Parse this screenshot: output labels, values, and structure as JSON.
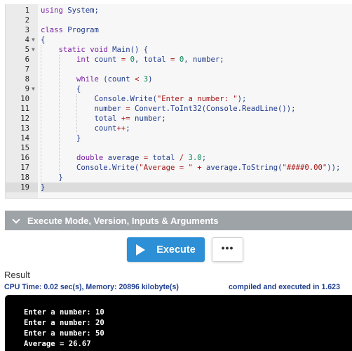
{
  "editor": {
    "lines": [
      {
        "n": "1",
        "tokens": [
          [
            "kw",
            "using"
          ],
          [
            "p",
            " System;"
          ]
        ]
      },
      {
        "n": "2",
        "tokens": []
      },
      {
        "n": "3",
        "tokens": [
          [
            "kw",
            "class"
          ],
          [
            "p",
            " Program"
          ]
        ]
      },
      {
        "n": "4",
        "fold": true,
        "tokens": [
          [
            "p",
            "{"
          ]
        ]
      },
      {
        "n": "5",
        "fold": true,
        "tokens": [
          [
            "p",
            "    "
          ],
          [
            "kw",
            "static"
          ],
          [
            "p",
            " "
          ],
          [
            "kw",
            "void"
          ],
          [
            "p",
            " Main() {"
          ]
        ]
      },
      {
        "n": "6",
        "tokens": [
          [
            "p",
            "        "
          ],
          [
            "ty",
            "int"
          ],
          [
            "p",
            " count "
          ],
          [
            "op",
            "="
          ],
          [
            "p",
            " "
          ],
          [
            "num",
            "0"
          ],
          [
            "p",
            ", total "
          ],
          [
            "op",
            "="
          ],
          [
            "p",
            " "
          ],
          [
            "num",
            "0"
          ],
          [
            "p",
            ", number;"
          ]
        ]
      },
      {
        "n": "7",
        "tokens": []
      },
      {
        "n": "8",
        "tokens": [
          [
            "p",
            "        "
          ],
          [
            "kw",
            "while"
          ],
          [
            "p",
            " (count "
          ],
          [
            "op",
            "<"
          ],
          [
            "p",
            " "
          ],
          [
            "num",
            "3"
          ],
          [
            "p",
            ")"
          ]
        ]
      },
      {
        "n": "9",
        "fold": true,
        "tokens": [
          [
            "p",
            "        {"
          ]
        ]
      },
      {
        "n": "10",
        "tokens": [
          [
            "p",
            "            Console.Write("
          ],
          [
            "str",
            "\"Enter a number: \""
          ],
          [
            "p",
            ");"
          ]
        ]
      },
      {
        "n": "11",
        "tokens": [
          [
            "p",
            "            number "
          ],
          [
            "op",
            "="
          ],
          [
            "p",
            " Convert.ToInt32(Console.ReadLine());"
          ]
        ]
      },
      {
        "n": "12",
        "tokens": [
          [
            "p",
            "            total "
          ],
          [
            "op",
            "+="
          ],
          [
            "p",
            " number;"
          ]
        ]
      },
      {
        "n": "13",
        "tokens": [
          [
            "p",
            "            count"
          ],
          [
            "op",
            "++"
          ],
          [
            "p",
            ";"
          ]
        ]
      },
      {
        "n": "14",
        "tokens": [
          [
            "p",
            "        }"
          ]
        ]
      },
      {
        "n": "15",
        "tokens": []
      },
      {
        "n": "16",
        "tokens": [
          [
            "p",
            "        "
          ],
          [
            "ty",
            "double"
          ],
          [
            "p",
            " average "
          ],
          [
            "op",
            "="
          ],
          [
            "p",
            " total "
          ],
          [
            "op",
            "/"
          ],
          [
            "p",
            " "
          ],
          [
            "num",
            "3.0"
          ],
          [
            "p",
            ";"
          ]
        ]
      },
      {
        "n": "17",
        "tokens": [
          [
            "p",
            "        Console.Write("
          ],
          [
            "str",
            "\"Average = \""
          ],
          [
            "p",
            " "
          ],
          [
            "op",
            "+"
          ],
          [
            "p",
            " average.ToString("
          ],
          [
            "str",
            "\"####0.00\""
          ],
          [
            "p",
            "));"
          ]
        ]
      },
      {
        "n": "18",
        "tokens": [
          [
            "p",
            "    }"
          ]
        ]
      },
      {
        "n": "19",
        "active": true,
        "tokens": [
          [
            "p",
            "}"
          ]
        ]
      }
    ]
  },
  "execute_section": {
    "title": "Execute Mode, Version, Inputs & Arguments",
    "execute_label": "Execute",
    "more_label": "•••"
  },
  "result": {
    "title": "Result",
    "stats": "CPU Time: 0.02 sec(s), Memory: 20896 kilobyte(s)",
    "compiled": "compiled and executed in 1.623",
    "output": [
      "Enter a number: 10",
      "Enter a number: 20",
      "Enter a number: 50",
      "Average = 26.67"
    ]
  },
  "colors": {
    "keyword": "#7a1fa2",
    "number": "#098658",
    "string": "#a31515",
    "text": "#1f3a8a",
    "execute_button": "#2d8fd5",
    "section_bar": "#9ea3a8",
    "console_bg": "#000000"
  },
  "icons": {
    "section_toggle": "chevron-down-icon",
    "execute": "play-icon",
    "more": "more-dots-icon"
  }
}
